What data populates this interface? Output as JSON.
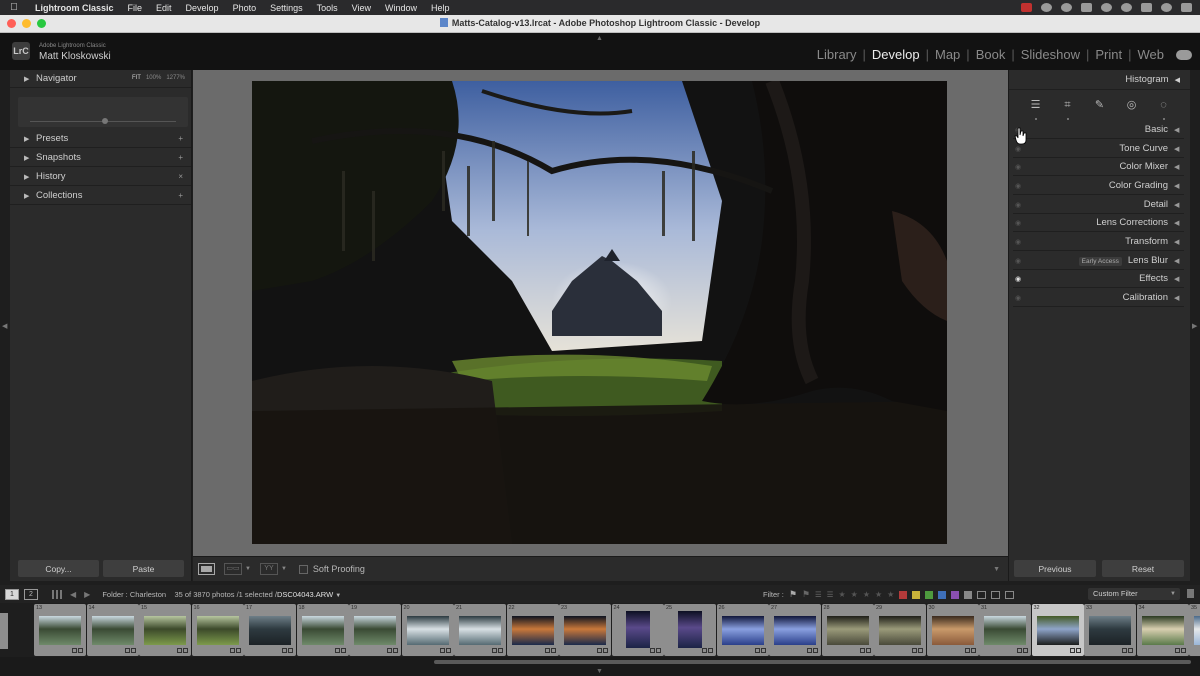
{
  "menubar": {
    "app": "Lightroom Classic",
    "items": [
      "File",
      "Edit",
      "Develop",
      "Photo",
      "Settings",
      "Tools",
      "View",
      "Window",
      "Help"
    ]
  },
  "window": {
    "title": "Matts-Catalog-v13.lrcat - Adobe Photoshop Lightroom Classic - Develop"
  },
  "identity": {
    "badge": "LrC",
    "product": "Adobe Lightroom Classic",
    "user": "Matt Kloskowski",
    "modules": [
      {
        "label": "Library",
        "active": false
      },
      {
        "label": "Develop",
        "active": true
      },
      {
        "label": "Map",
        "active": false
      },
      {
        "label": "Book",
        "active": false
      },
      {
        "label": "Slideshow",
        "active": false
      },
      {
        "label": "Print",
        "active": false
      },
      {
        "label": "Web",
        "active": false
      }
    ]
  },
  "left_panel": {
    "navigator": {
      "label": "Navigator",
      "zoom": [
        "FIT",
        "100%",
        "1277%"
      ]
    },
    "panels": [
      {
        "label": "Presets",
        "action": "+"
      },
      {
        "label": "Snapshots",
        "action": "+"
      },
      {
        "label": "History",
        "action": "×"
      },
      {
        "label": "Collections",
        "action": "+"
      }
    ],
    "copy_label": "Copy...",
    "paste_label": "Paste"
  },
  "toolbar": {
    "soft_proofing": "Soft Proofing"
  },
  "right_panel": {
    "histogram": "Histogram",
    "tools": [
      "edit-sliders",
      "crop",
      "healing",
      "red-eye",
      "masking"
    ],
    "panels": [
      {
        "label": "Basic",
        "eye": false,
        "badge": ""
      },
      {
        "label": "Tone Curve",
        "eye": false,
        "badge": ""
      },
      {
        "label": "Color Mixer",
        "eye": false,
        "badge": ""
      },
      {
        "label": "Color Grading",
        "eye": false,
        "badge": ""
      },
      {
        "label": "Detail",
        "eye": false,
        "badge": ""
      },
      {
        "label": "Lens Corrections",
        "eye": false,
        "badge": ""
      },
      {
        "label": "Transform",
        "eye": false,
        "badge": ""
      },
      {
        "label": "Lens Blur",
        "eye": false,
        "badge": "Early Access"
      },
      {
        "label": "Effects",
        "eye": true,
        "badge": ""
      },
      {
        "label": "Calibration",
        "eye": false,
        "badge": ""
      }
    ],
    "previous_label": "Previous",
    "reset_label": "Reset"
  },
  "filmstrip": {
    "monitors": [
      "1",
      "2"
    ],
    "folder": "Folder : Charleston",
    "count": "35 of 3870 photos /1 selected /",
    "selected_file": "DSC04043.ARW",
    "filter_label": "Filter :",
    "custom_filter": "Custom Filter",
    "thumbs": [
      {
        "num": "13",
        "tone": "trees",
        "tall": false,
        "sel": false
      },
      {
        "num": "14",
        "tone": "trees",
        "tall": false,
        "sel": false
      },
      {
        "num": "15",
        "tone": "green",
        "tall": false,
        "sel": false
      },
      {
        "num": "16",
        "tone": "green",
        "tall": false,
        "sel": false
      },
      {
        "num": "17",
        "tone": "dark",
        "tall": false,
        "sel": false
      },
      {
        "num": "18",
        "tone": "trees",
        "tall": false,
        "sel": false
      },
      {
        "num": "19",
        "tone": "trees",
        "tall": false,
        "sel": false
      },
      {
        "num": "20",
        "tone": "bird",
        "tall": false,
        "sel": false
      },
      {
        "num": "21",
        "tone": "bird",
        "tall": false,
        "sel": false
      },
      {
        "num": "22",
        "tone": "sunset",
        "tall": false,
        "sel": false
      },
      {
        "num": "23",
        "tone": "sunset",
        "tall": false,
        "sel": false
      },
      {
        "num": "24",
        "tone": "night",
        "tall": true,
        "sel": false
      },
      {
        "num": "25",
        "tone": "night",
        "tall": true,
        "sel": false
      },
      {
        "num": "26",
        "tone": "dusk",
        "tall": false,
        "sel": false
      },
      {
        "num": "27",
        "tone": "dusk",
        "tall": false,
        "sel": false
      },
      {
        "num": "28",
        "tone": "oak",
        "tall": false,
        "sel": false
      },
      {
        "num": "29",
        "tone": "oak",
        "tall": false,
        "sel": false
      },
      {
        "num": "30",
        "tone": "warm",
        "tall": false,
        "sel": false
      },
      {
        "num": "31",
        "tone": "trees",
        "tall": false,
        "sel": false
      },
      {
        "num": "32",
        "tone": "house",
        "tall": false,
        "sel": true
      },
      {
        "num": "33",
        "tone": "dark",
        "tall": false,
        "sel": false
      },
      {
        "num": "34",
        "tone": "garden",
        "tall": false,
        "sel": false
      },
      {
        "num": "35",
        "tone": "beach",
        "tall": false,
        "sel": false
      }
    ]
  },
  "colors": {
    "label_swatches": [
      "#b33a3a",
      "#c9b23a",
      "#4e9a3e",
      "#3e6fb8",
      "#8a4fb0"
    ]
  }
}
